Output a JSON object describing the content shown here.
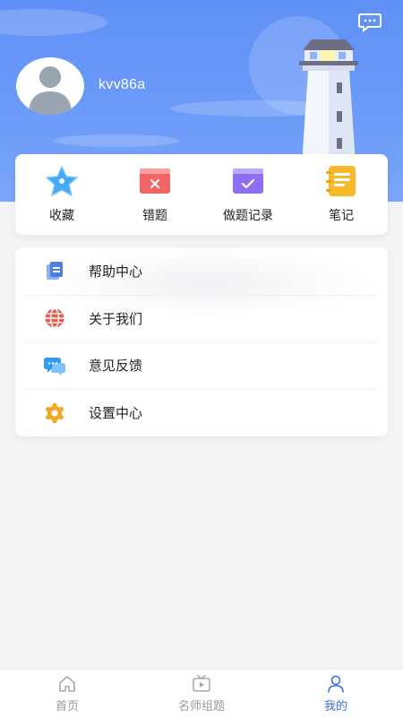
{
  "header": {
    "username": "kvv86a",
    "icons": {
      "message": "message-icon",
      "avatar": "user-avatar-icon",
      "illustration": "lighthouse-illustration"
    }
  },
  "quick_actions": [
    {
      "label": "收藏",
      "icon": "star-icon",
      "color": "#3aa3f5"
    },
    {
      "label": "错题",
      "icon": "wrong-questions-icon",
      "color": "#f06060"
    },
    {
      "label": "做题记录",
      "icon": "practice-record-icon",
      "color": "#8b6cf0"
    },
    {
      "label": "笔记",
      "icon": "notebook-icon",
      "color": "#f6b72a"
    }
  ],
  "menu": [
    {
      "label": "帮助中心",
      "icon": "document-icon",
      "color": "#4d7fe0"
    },
    {
      "label": "关于我们",
      "icon": "globe-icon",
      "color": "#e45d52"
    },
    {
      "label": "意见反馈",
      "icon": "chat-bubbles-icon",
      "color": "#2f9bef"
    },
    {
      "label": "设置中心",
      "icon": "gear-icon",
      "color": "#f1a826"
    }
  ],
  "bottom_nav": [
    {
      "label": "首页",
      "icon": "home-icon",
      "active": false
    },
    {
      "label": "名师组题",
      "icon": "tv-play-icon",
      "active": false
    },
    {
      "label": "我的",
      "icon": "person-icon",
      "active": true
    }
  ],
  "colors": {
    "header": "#6a98f8",
    "active": "#3d6fe0",
    "inactive": "#9a9a9a"
  }
}
